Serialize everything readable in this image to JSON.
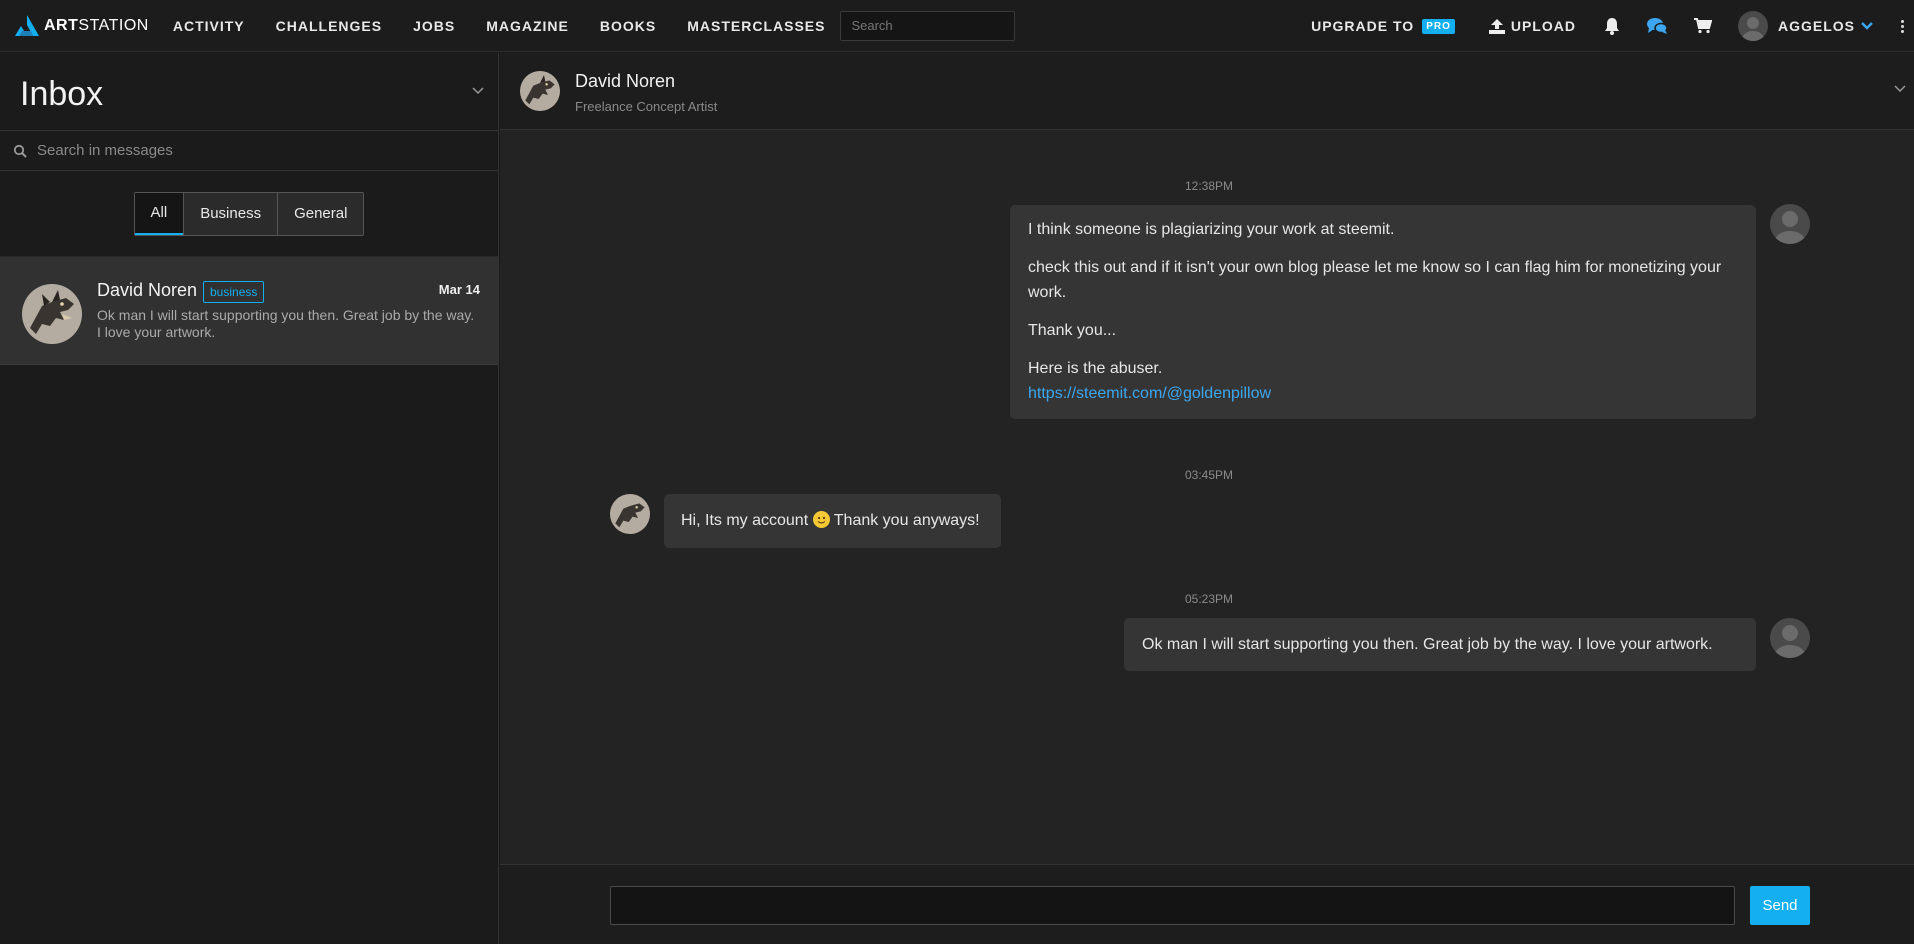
{
  "brand": {
    "name_bold": "ART",
    "name_light": "STATION"
  },
  "nav": {
    "links": [
      "ACTIVITY",
      "CHALLENGES",
      "JOBS",
      "MAGAZINE",
      "BOOKS",
      "MASTERCLASSES"
    ],
    "search_placeholder": "Search",
    "upgrade_label": "UPGRADE TO",
    "pro_badge": "PRO",
    "upload_label": "UPLOAD",
    "username": "AGGELOS",
    "icons": [
      "bell-icon",
      "chat-bubbles-icon",
      "cart-icon",
      "user-avatar",
      "chevron-down-icon",
      "kebab-menu-icon"
    ]
  },
  "sidebar": {
    "title": "Inbox",
    "search_placeholder": "Search in messages",
    "filters": [
      {
        "label": "All",
        "active": true
      },
      {
        "label": "Business",
        "active": false
      },
      {
        "label": "General",
        "active": false
      }
    ],
    "conversations": [
      {
        "name": "David Noren",
        "tag": "business",
        "date": "Mar 14",
        "preview": "Ok man I will start supporting you then. Great job by the way. I love your artwork."
      }
    ]
  },
  "chat": {
    "contact_name": "David Noren",
    "contact_role": "Freelance Concept Artist",
    "messages": [
      {
        "time": "12:38PM",
        "sender": "me",
        "lines": [
          "I think someone is plagiarizing your work at steemit.",
          "check this out and if it isn't your own blog please let me know so I can flag him for monetizing your work.",
          "Thank you...",
          "Here is the abuser."
        ],
        "link": "https://steemit.com/@goldenpillow"
      },
      {
        "time": "03:45PM",
        "sender": "them",
        "text_before_emoji": "Hi, Its my account",
        "text_after_emoji": "Thank you anyways!"
      },
      {
        "time": "05:23PM",
        "sender": "me",
        "text": "Ok man I will start supporting you then. Great job by the way. I love your artwork."
      }
    ],
    "composer": {
      "value": "",
      "send_label": "Send"
    }
  },
  "colors": {
    "accent": "#13aff0",
    "link": "#3ca7f0",
    "bubble": "#353535",
    "background": "#232323"
  }
}
